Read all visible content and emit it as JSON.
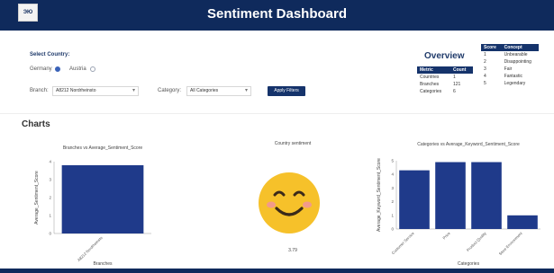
{
  "header": {
    "title": "Sentiment Dashboard",
    "logo_text": "ЭЮ"
  },
  "filters": {
    "select_country_label": "Select Country:",
    "country_options": [
      {
        "label": "Germany",
        "selected": true
      },
      {
        "label": "Austria",
        "selected": false
      }
    ],
    "branch_label": "Branch:",
    "branch_value": "A8212 Nordrheinsto",
    "category_label": "Category:",
    "category_value": "All Categories",
    "apply_label": "Apply Filters"
  },
  "overview": {
    "title": "Overview",
    "columns": [
      "Metric",
      "Count"
    ],
    "rows": [
      [
        "Countries",
        "1"
      ],
      [
        "Branches",
        "121"
      ],
      [
        "Categories",
        "6"
      ]
    ]
  },
  "score_table": {
    "columns": [
      "Score",
      "Concept"
    ],
    "rows": [
      [
        "1",
        "Unbearable"
      ],
      [
        "2",
        "Disappointing"
      ],
      [
        "3",
        "Fair"
      ],
      [
        "4",
        "Fantastic"
      ],
      [
        "5",
        "Legendary"
      ]
    ]
  },
  "charts_label": "Charts",
  "chart_data": [
    {
      "type": "bar",
      "title": "Branches vs Average_Sentiment_Score",
      "xlabel": "Branches",
      "ylabel": "Average_Sentiment_Score",
      "categories": [
        "A8212 Nordrheinsto"
      ],
      "values": [
        3.8
      ],
      "ylim": [
        0,
        4
      ],
      "yticks": [
        "0",
        "1",
        "2",
        "3",
        "4"
      ],
      "color": "#1f3a8a"
    },
    {
      "type": "bar",
      "title": "Categories vs Average_Keyword_Sentiment_Score",
      "xlabel": "Categories",
      "ylabel": "Average_Keyword_Sentiment_Score",
      "categories": [
        "Customer Service",
        "Price",
        "Product Quality",
        "Store Environment"
      ],
      "values": [
        4.3,
        4.9,
        4.9,
        1.0
      ],
      "ylim": [
        0,
        5
      ],
      "yticks": [
        "0",
        "1",
        "2",
        "3",
        "4",
        "5"
      ],
      "color": "#1f3a8a"
    }
  ],
  "country_sentiment": {
    "title": "Country sentiment",
    "value": "3.79"
  }
}
